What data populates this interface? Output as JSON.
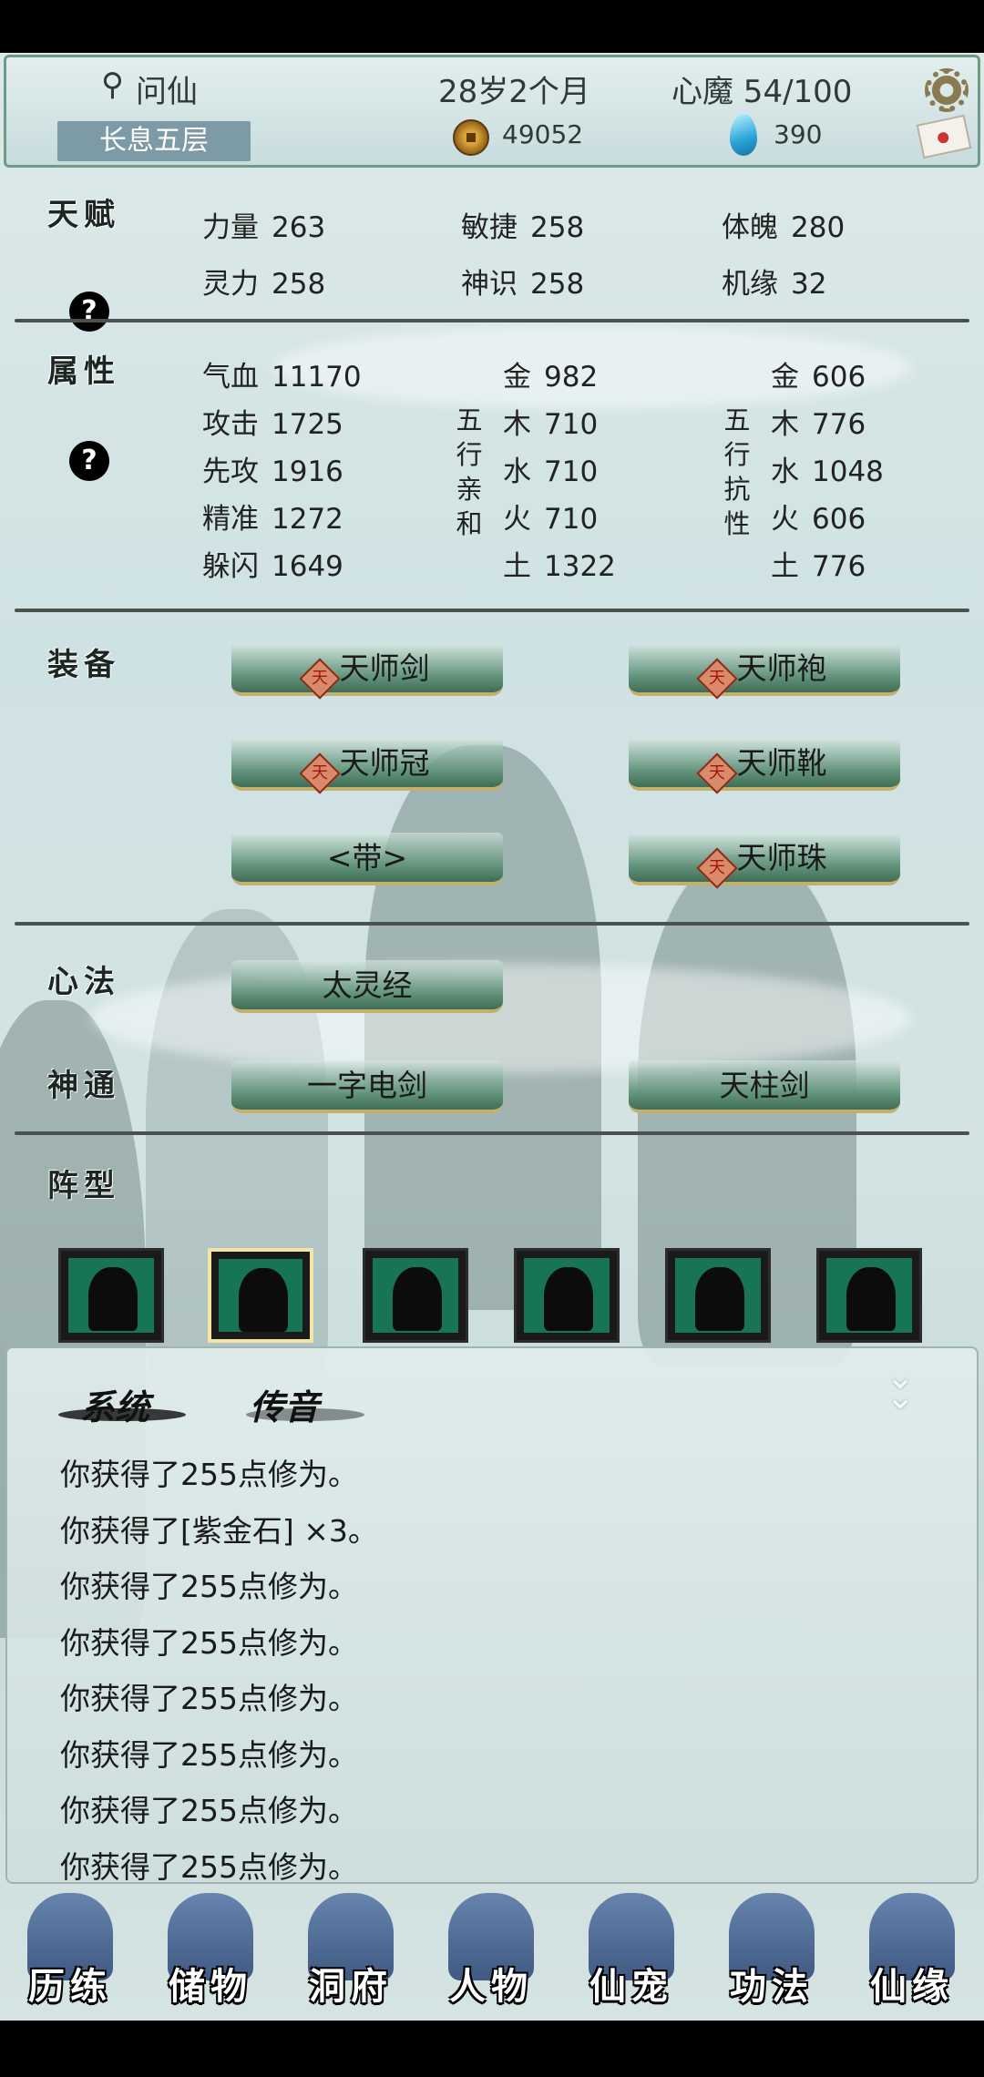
{
  "header": {
    "name": "问仙",
    "realm": "长息五层",
    "age": "28岁2个月",
    "demon": "心魔  54/100",
    "coins": "49052",
    "gems": "390"
  },
  "talent": {
    "label": "天赋",
    "help": "?",
    "stats": [
      {
        "k": "力量",
        "v": "263"
      },
      {
        "k": "敏捷",
        "v": "258"
      },
      {
        "k": "体魄",
        "v": "280"
      },
      {
        "k": "灵力",
        "v": "258"
      },
      {
        "k": "神识",
        "v": "258"
      },
      {
        "k": "机缘",
        "v": "32"
      }
    ]
  },
  "attributes": {
    "label": "属性",
    "help": "?",
    "base": [
      {
        "k": "气血",
        "v": "11170"
      },
      {
        "k": "攻击",
        "v": "1725"
      },
      {
        "k": "先攻",
        "v": "1916"
      },
      {
        "k": "精准",
        "v": "1272"
      },
      {
        "k": "躲闪",
        "v": "1649"
      }
    ],
    "affinity_label": [
      "五",
      "行",
      "亲",
      "和"
    ],
    "affinity": [
      {
        "k": "金",
        "v": "982"
      },
      {
        "k": "木",
        "v": "710"
      },
      {
        "k": "水",
        "v": "710"
      },
      {
        "k": "火",
        "v": "710"
      },
      {
        "k": "土",
        "v": "1322"
      }
    ],
    "resist_label": [
      "五",
      "行",
      "抗",
      "性"
    ],
    "resist": [
      {
        "k": "金",
        "v": "606"
      },
      {
        "k": "木",
        "v": "776"
      },
      {
        "k": "水",
        "v": "1048"
      },
      {
        "k": "火",
        "v": "606"
      },
      {
        "k": "土",
        "v": "776"
      }
    ]
  },
  "equipment": {
    "label": "装备",
    "badge": "天",
    "items": [
      "天师剑",
      "天师袍",
      "天师冠",
      "天师靴",
      "<带>",
      "天师珠"
    ]
  },
  "method": {
    "label": "心法",
    "items": [
      "太灵经"
    ]
  },
  "skills": {
    "label": "神通",
    "items": [
      "一字电剑",
      "天柱剑"
    ]
  },
  "formation": {
    "label": "阵型",
    "selected_index": 1
  },
  "messages": {
    "tabs": [
      "系统",
      "传音"
    ],
    "collapse_icon": "double-chevron-down-icon",
    "lines": [
      "你获得了255点修为。",
      "你获得了[紫金石] ×3。",
      "你获得了255点修为。",
      "你获得了255点修为。",
      "你获得了255点修为。",
      "你获得了255点修为。",
      "你获得了255点修为。",
      "你获得了255点修为。"
    ]
  },
  "nav": [
    "历练",
    "储物",
    "洞府",
    "人物",
    "仙宠",
    "功法",
    "仙缘"
  ],
  "colors": {
    "accent": "#177556",
    "panel": "#cfe2e3",
    "gold": "#c3b06c"
  }
}
